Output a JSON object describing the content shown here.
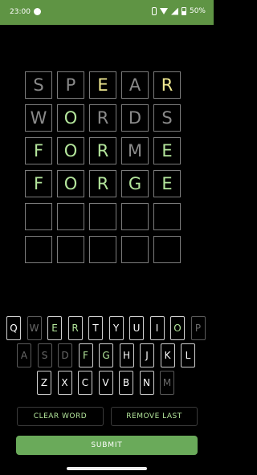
{
  "status_bar": {
    "time": "23:00",
    "battery": "50%"
  },
  "colors": {
    "status_bar": "#5f9444",
    "correct": "#b3e59b",
    "present": "#f1ea92",
    "absent": "#8a8a8a",
    "submit": "#6aaa5a"
  },
  "grid": [
    [
      {
        "l": "S",
        "s": "absent"
      },
      {
        "l": "P",
        "s": "absent"
      },
      {
        "l": "E",
        "s": "present"
      },
      {
        "l": "A",
        "s": "absent"
      },
      {
        "l": "R",
        "s": "present"
      }
    ],
    [
      {
        "l": "W",
        "s": "absent"
      },
      {
        "l": "O",
        "s": "correct"
      },
      {
        "l": "R",
        "s": "absent"
      },
      {
        "l": "D",
        "s": "absent"
      },
      {
        "l": "S",
        "s": "absent"
      }
    ],
    [
      {
        "l": "F",
        "s": "correct"
      },
      {
        "l": "O",
        "s": "correct"
      },
      {
        "l": "R",
        "s": "correct"
      },
      {
        "l": "M",
        "s": "absent"
      },
      {
        "l": "E",
        "s": "correct"
      }
    ],
    [
      {
        "l": "F",
        "s": "correct"
      },
      {
        "l": "O",
        "s": "correct"
      },
      {
        "l": "R",
        "s": "correct"
      },
      {
        "l": "G",
        "s": "correct"
      },
      {
        "l": "E",
        "s": "correct"
      }
    ],
    [
      {
        "l": "",
        "s": "empty"
      },
      {
        "l": "",
        "s": "empty"
      },
      {
        "l": "",
        "s": "empty"
      },
      {
        "l": "",
        "s": "empty"
      },
      {
        "l": "",
        "s": "empty"
      }
    ],
    [
      {
        "l": "",
        "s": "empty"
      },
      {
        "l": "",
        "s": "empty"
      },
      {
        "l": "",
        "s": "empty"
      },
      {
        "l": "",
        "s": "empty"
      },
      {
        "l": "",
        "s": "empty"
      }
    ]
  ],
  "keyboard": {
    "row1": [
      {
        "k": "Q",
        "s": ""
      },
      {
        "k": "W",
        "s": "absent"
      },
      {
        "k": "E",
        "s": "correct"
      },
      {
        "k": "R",
        "s": "correct"
      },
      {
        "k": "T",
        "s": ""
      },
      {
        "k": "Y",
        "s": ""
      },
      {
        "k": "U",
        "s": ""
      },
      {
        "k": "I",
        "s": ""
      },
      {
        "k": "O",
        "s": "correct"
      },
      {
        "k": "P",
        "s": "absent"
      }
    ],
    "row2": [
      {
        "k": "A",
        "s": "absent"
      },
      {
        "k": "S",
        "s": "absent"
      },
      {
        "k": "D",
        "s": "absent"
      },
      {
        "k": "F",
        "s": "correct"
      },
      {
        "k": "G",
        "s": "correct"
      },
      {
        "k": "H",
        "s": ""
      },
      {
        "k": "J",
        "s": ""
      },
      {
        "k": "K",
        "s": ""
      },
      {
        "k": "L",
        "s": ""
      }
    ],
    "row3": [
      {
        "k": "Z",
        "s": ""
      },
      {
        "k": "X",
        "s": ""
      },
      {
        "k": "C",
        "s": ""
      },
      {
        "k": "V",
        "s": ""
      },
      {
        "k": "B",
        "s": ""
      },
      {
        "k": "N",
        "s": ""
      },
      {
        "k": "M",
        "s": "absent"
      }
    ]
  },
  "buttons": {
    "clear": "CLEAR WORD",
    "remove": "REMOVE LAST",
    "submit": "SUBMIT"
  }
}
